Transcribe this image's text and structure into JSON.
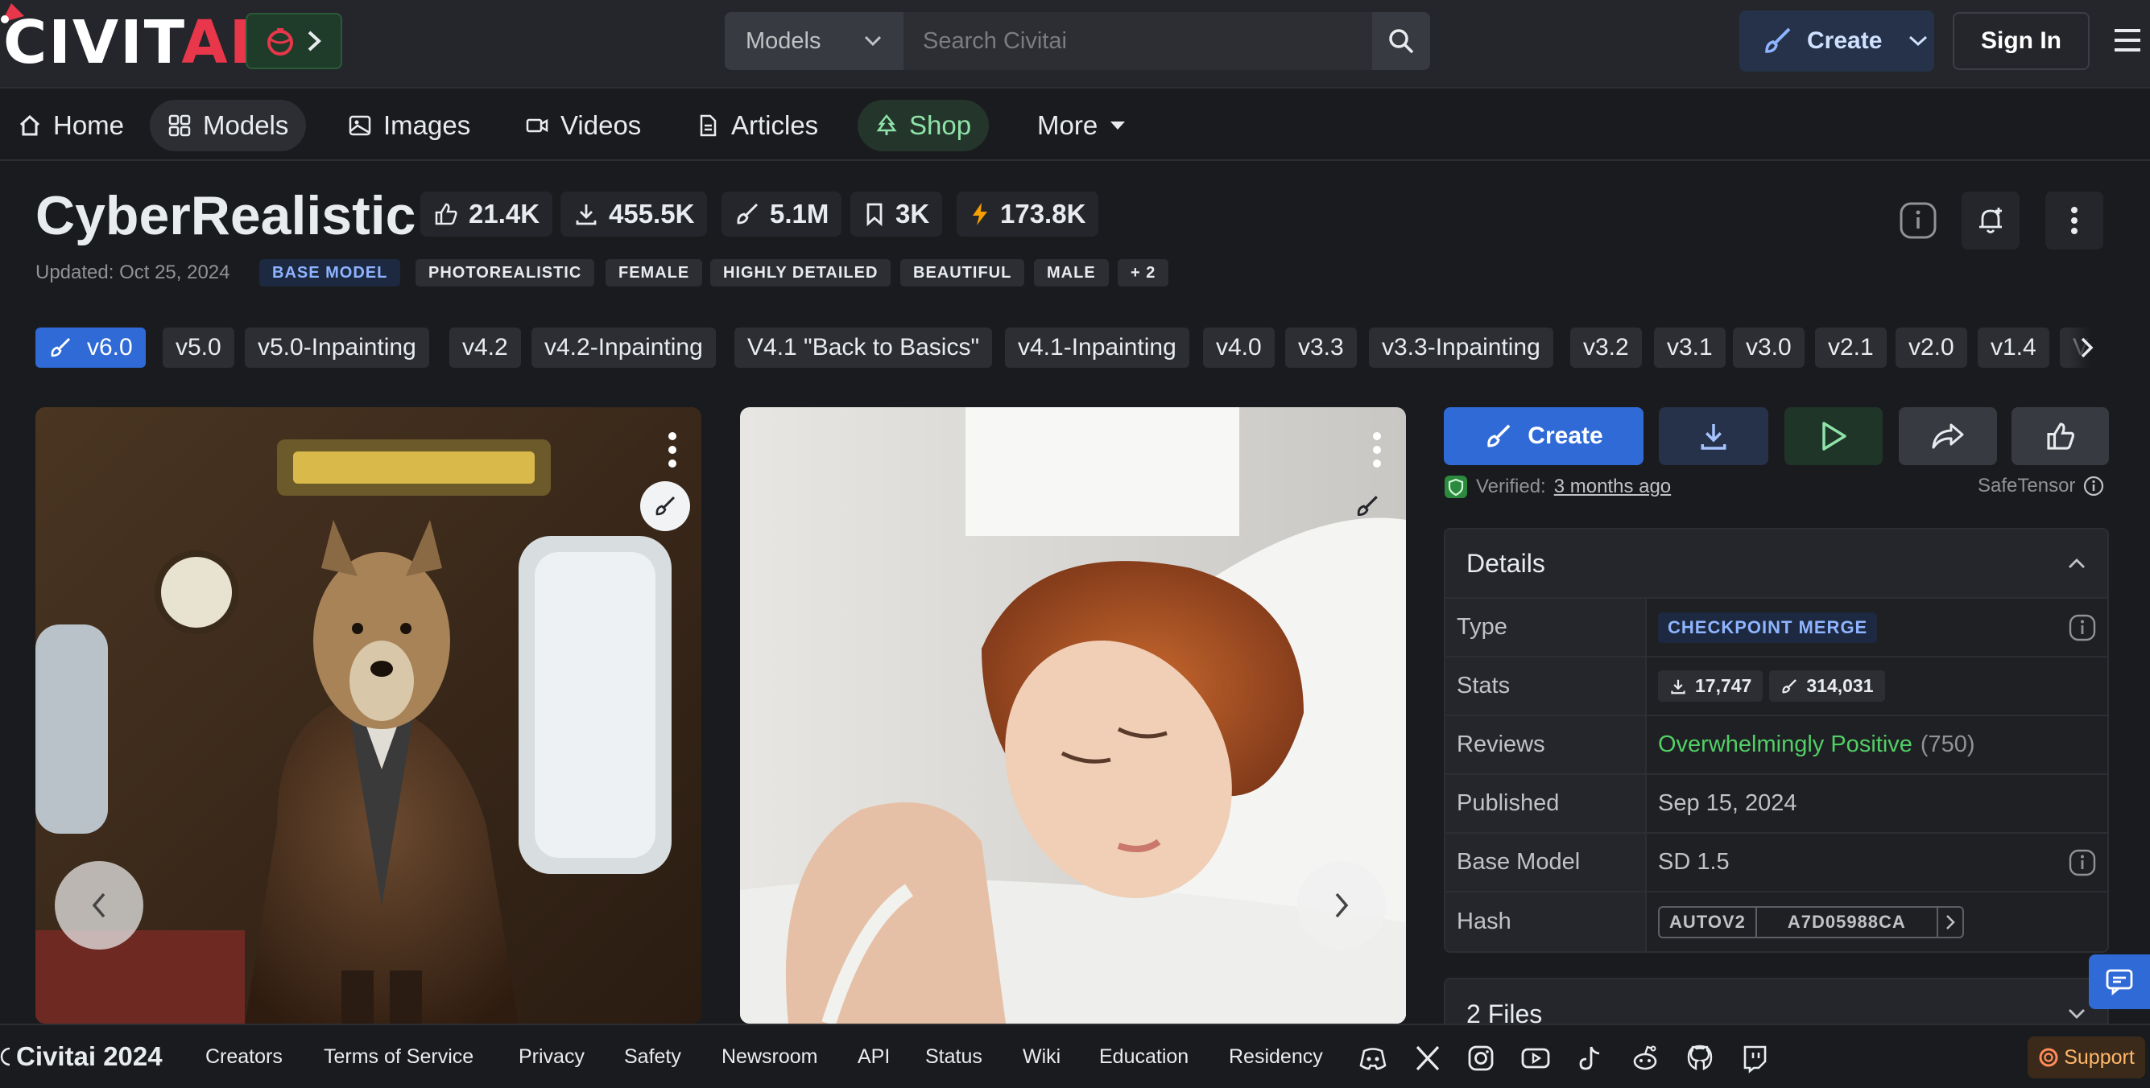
{
  "header": {
    "logo_main": "CIVIT",
    "logo_ai": "AI",
    "search_category": "Models",
    "search_placeholder": "Search Civitai",
    "slash": "/",
    "create_label": "Create",
    "signin_label": "Sign In"
  },
  "nav": {
    "items": [
      {
        "label": "Home",
        "icon": "home-icon"
      },
      {
        "label": "Models",
        "icon": "grid-icon"
      },
      {
        "label": "Images",
        "icon": "photo-icon"
      },
      {
        "label": "Videos",
        "icon": "video-icon"
      },
      {
        "label": "Articles",
        "icon": "file-icon"
      },
      {
        "label": "Shop",
        "icon": "tree-icon"
      },
      {
        "label": "More",
        "icon": "caret-down-icon"
      }
    ]
  },
  "model": {
    "title": "CyberRealistic",
    "stats": {
      "likes": "21.4K",
      "downloads": "455.5K",
      "generations": "5.1M",
      "bookmarks": "3K",
      "buzz": "173.8K"
    },
    "updated": "Updated: Oct 25, 2024",
    "tags": [
      "BASE MODEL",
      "PHOTOREALISTIC",
      "FEMALE",
      "HIGHLY DETAILED",
      "BEAUTIFUL",
      "MALE",
      "+ 2"
    ]
  },
  "versions": [
    "v6.0",
    "v5.0",
    "v5.0-Inpainting",
    "v4.2",
    "v4.2-Inpainting",
    "V4.1 \"Back to Basics\"",
    "v4.1-Inpainting",
    "v4.0",
    "v3.3",
    "v3.3-Inpainting",
    "v3.2",
    "v3.1",
    "v3.0",
    "v2.1",
    "v2.0",
    "v1.4",
    "V"
  ],
  "actions": {
    "create_label": "Create",
    "verified_label": "Verified:",
    "verified_time": "3 months ago",
    "format": "SafeTensor"
  },
  "details": {
    "heading": "Details",
    "rows": {
      "type_label": "Type",
      "type_value": "CHECKPOINT MERGE",
      "stats_label": "Stats",
      "stats_downloads": "17,747",
      "stats_generations": "314,031",
      "reviews_label": "Reviews",
      "reviews_value": "Overwhelmingly Positive",
      "reviews_count": "(750)",
      "published_label": "Published",
      "published_value": "Sep 15, 2024",
      "base_label": "Base Model",
      "base_value": "SD 1.5",
      "hash_label": "Hash",
      "hash_type": "AUTOV2",
      "hash_value": "A7D05988CA"
    },
    "files_label": "2 Files"
  },
  "footer": {
    "copyright": "Civitai 2024",
    "links": [
      "Creators",
      "Terms of Service",
      "Privacy",
      "Safety",
      "Newsroom",
      "API",
      "Status",
      "Wiki",
      "Education",
      "Residency"
    ],
    "support_label": "Support"
  },
  "colors": {
    "accent": "#2f6ad6",
    "brand_red": "#e8374a",
    "positive": "#51cf66",
    "shop_green": "#8ee3a8"
  }
}
